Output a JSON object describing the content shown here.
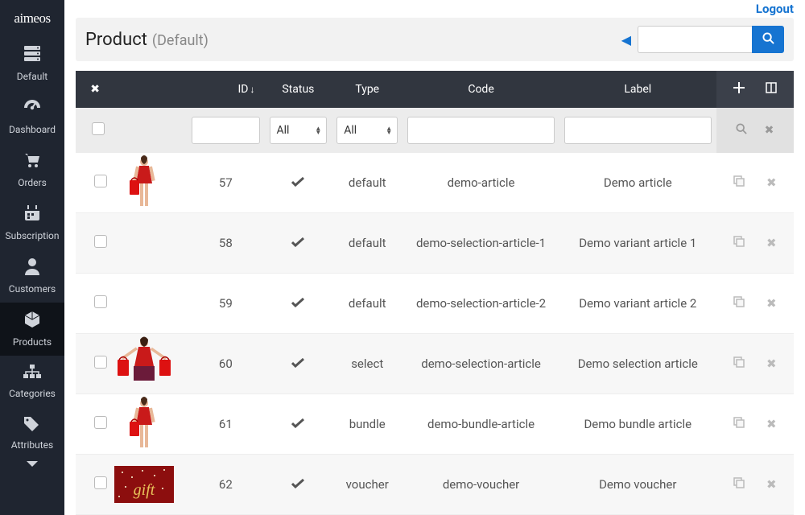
{
  "brand": "aimeos",
  "auth": {
    "logout": "Logout"
  },
  "header": {
    "title": "Product",
    "subtitle": "(Default)"
  },
  "sidebar": {
    "items": [
      {
        "id": "default",
        "label": "Default",
        "icon": "server-icon"
      },
      {
        "id": "dashboard",
        "label": "Dashboard",
        "icon": "gauge-icon"
      },
      {
        "id": "orders",
        "label": "Orders",
        "icon": "cart-icon"
      },
      {
        "id": "subscription",
        "label": "Subscription",
        "icon": "calendar-icon"
      },
      {
        "id": "customers",
        "label": "Customers",
        "icon": "user-icon"
      },
      {
        "id": "products",
        "label": "Products",
        "icon": "cube-icon",
        "active": true
      },
      {
        "id": "categories",
        "label": "Categories",
        "icon": "sitemap-icon"
      },
      {
        "id": "attributes",
        "label": "Attributes",
        "icon": "tags-icon"
      }
    ]
  },
  "table": {
    "headers": {
      "id": "ID",
      "status": "Status",
      "type": "Type",
      "code": "Code",
      "label": "Label"
    },
    "filters": {
      "status_all": "All",
      "type_all": "All"
    },
    "rows": [
      {
        "id": "57",
        "status": "enabled",
        "type": "default",
        "code": "demo-article",
        "label": "Demo article",
        "thumb": "model-bag"
      },
      {
        "id": "58",
        "status": "enabled",
        "type": "default",
        "code": "demo-selection-article-1",
        "label": "Demo variant article 1",
        "thumb": ""
      },
      {
        "id": "59",
        "status": "enabled",
        "type": "default",
        "code": "demo-selection-article-2",
        "label": "Demo variant article 2",
        "thumb": ""
      },
      {
        "id": "60",
        "status": "enabled",
        "type": "select",
        "code": "demo-selection-article",
        "label": "Demo selection article",
        "thumb": "model-arms"
      },
      {
        "id": "61",
        "status": "enabled",
        "type": "bundle",
        "code": "demo-bundle-article",
        "label": "Demo bundle article",
        "thumb": "model-bag"
      },
      {
        "id": "62",
        "status": "enabled",
        "type": "voucher",
        "code": "demo-voucher",
        "label": "Demo voucher",
        "thumb": "gift"
      }
    ]
  }
}
